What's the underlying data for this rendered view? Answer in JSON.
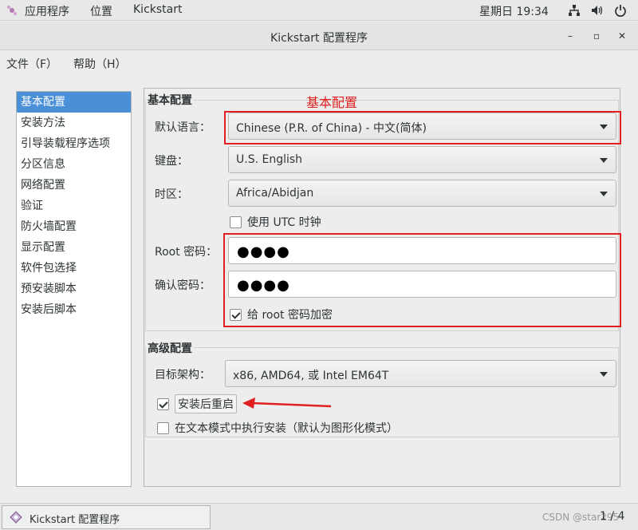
{
  "top_panel": {
    "applications": "应用程序",
    "places": "位置",
    "active_app": "Kickstart",
    "clock": "星期日 19:34"
  },
  "window": {
    "title": "Kickstart 配置程序",
    "minimize": "–",
    "maximize": "▫",
    "close": "✕"
  },
  "menubar": {
    "file": "文件（F）",
    "help": "帮助（H）"
  },
  "categories": [
    "基本配置",
    "安装方法",
    "引导装载程序选项",
    "分区信息",
    "网络配置",
    "验证",
    "防火墙配置",
    "显示配置",
    "软件包选择",
    "预安装脚本",
    "安装后脚本"
  ],
  "basic": {
    "section_title": "基本配置",
    "annotation": "基本配置",
    "language_label": "默认语言：",
    "language_value": "Chinese (P.R. of China) - 中文(简体)",
    "keyboard_label": "键盘：",
    "keyboard_value": "U.S. English",
    "timezone_label": "时区：",
    "timezone_value": "Africa/Abidjan",
    "utc_label": "使用  UTC 时钟",
    "utc_checked": false,
    "root_pw_label": "Root 密码：",
    "root_pw_value": "●●●●",
    "confirm_pw_label": "确认密码：",
    "confirm_pw_value": "●●●●",
    "encrypt_label": "给  root 密码加密",
    "encrypt_checked": true
  },
  "advanced": {
    "section_title": "高级配置",
    "arch_label": "目标架构：",
    "arch_value": "x86, AMD64, 或  Intel EM64T",
    "reboot_label": "安装后重启",
    "reboot_checked": true,
    "textmode_label": "在文本模式中执行安装（默认为图形化模式）",
    "textmode_checked": false
  },
  "taskbar": {
    "task_label": "Kickstart 配置程序",
    "pager": "1 / 4",
    "watermark": "CSDN @star295"
  },
  "colors": {
    "selection": "#4a90d9",
    "annotation_red": "#e02020"
  }
}
